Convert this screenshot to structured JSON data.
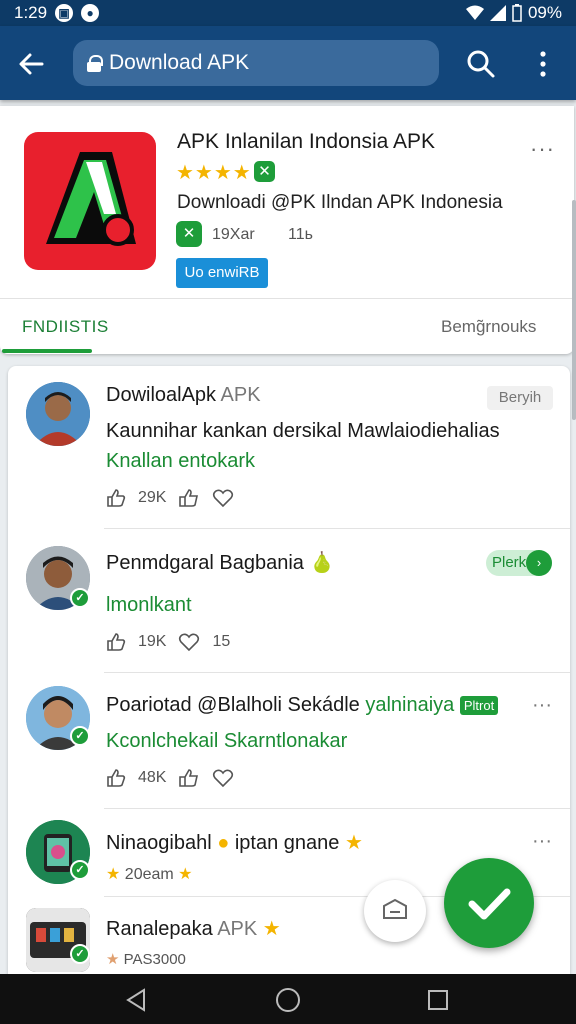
{
  "status_bar": {
    "time": "1:29",
    "battery": "09%",
    "icons": [
      "notification-icon",
      "notification-icon",
      "wifi-icon",
      "signal-icon",
      "battery-icon"
    ]
  },
  "app_bar": {
    "url_text": "Download APK",
    "icons": [
      "back-arrow-icon",
      "lock-icon",
      "search-icon",
      "more-vert-icon"
    ]
  },
  "app": {
    "title": "APK Inlanilan Indonsia APK",
    "stars": "★★★★",
    "rating_badge": "✕",
    "subtitle": "Downloadi  @PK Ilndan APK Indonesia",
    "mini_badge": "✕",
    "size": "19Xar",
    "count": "11ь",
    "install_label": "Uo enwiRB",
    "more": "···",
    "tabs": {
      "left": "FNDIISTIS",
      "right": "Bemg̃rnouks"
    }
  },
  "list": [
    {
      "title": "DowiloalApk",
      "title_suffix": "APK",
      "pill": "Beryih",
      "line1": "Kaunnihar kankan dersikal Mawlaiodiehalias",
      "line2": "Knallan entokark",
      "likes": "29K"
    },
    {
      "title": "Penmdgaral Bagbania",
      "title_emoji": "🍐",
      "pill": "Plerk",
      "line1": "lmonlkant",
      "likes": "19K",
      "hearts": "15"
    },
    {
      "title": "Poariotad @Blalholi Sekádle",
      "title_suffix": "yalninaiya",
      "tag": "Pltrot",
      "line1": "Kconlchekail Skarntlonakar",
      "likes": "48K",
      "more": "···"
    },
    {
      "title": "Ninaogibahl",
      "title_suffix": "iptan gnane",
      "line1": "20eam",
      "star": "★",
      "more": "···"
    },
    {
      "title": "Ranalepaka",
      "title_suffix": "APK",
      "line1": "PAS3000",
      "star": "★"
    }
  ],
  "colors": {
    "app_bar": "#12467b",
    "status_bar": "#0d3a66",
    "accent_green": "#1e9d3a",
    "install_blue": "#1a8fd8",
    "icon_red": "#e8202d"
  }
}
